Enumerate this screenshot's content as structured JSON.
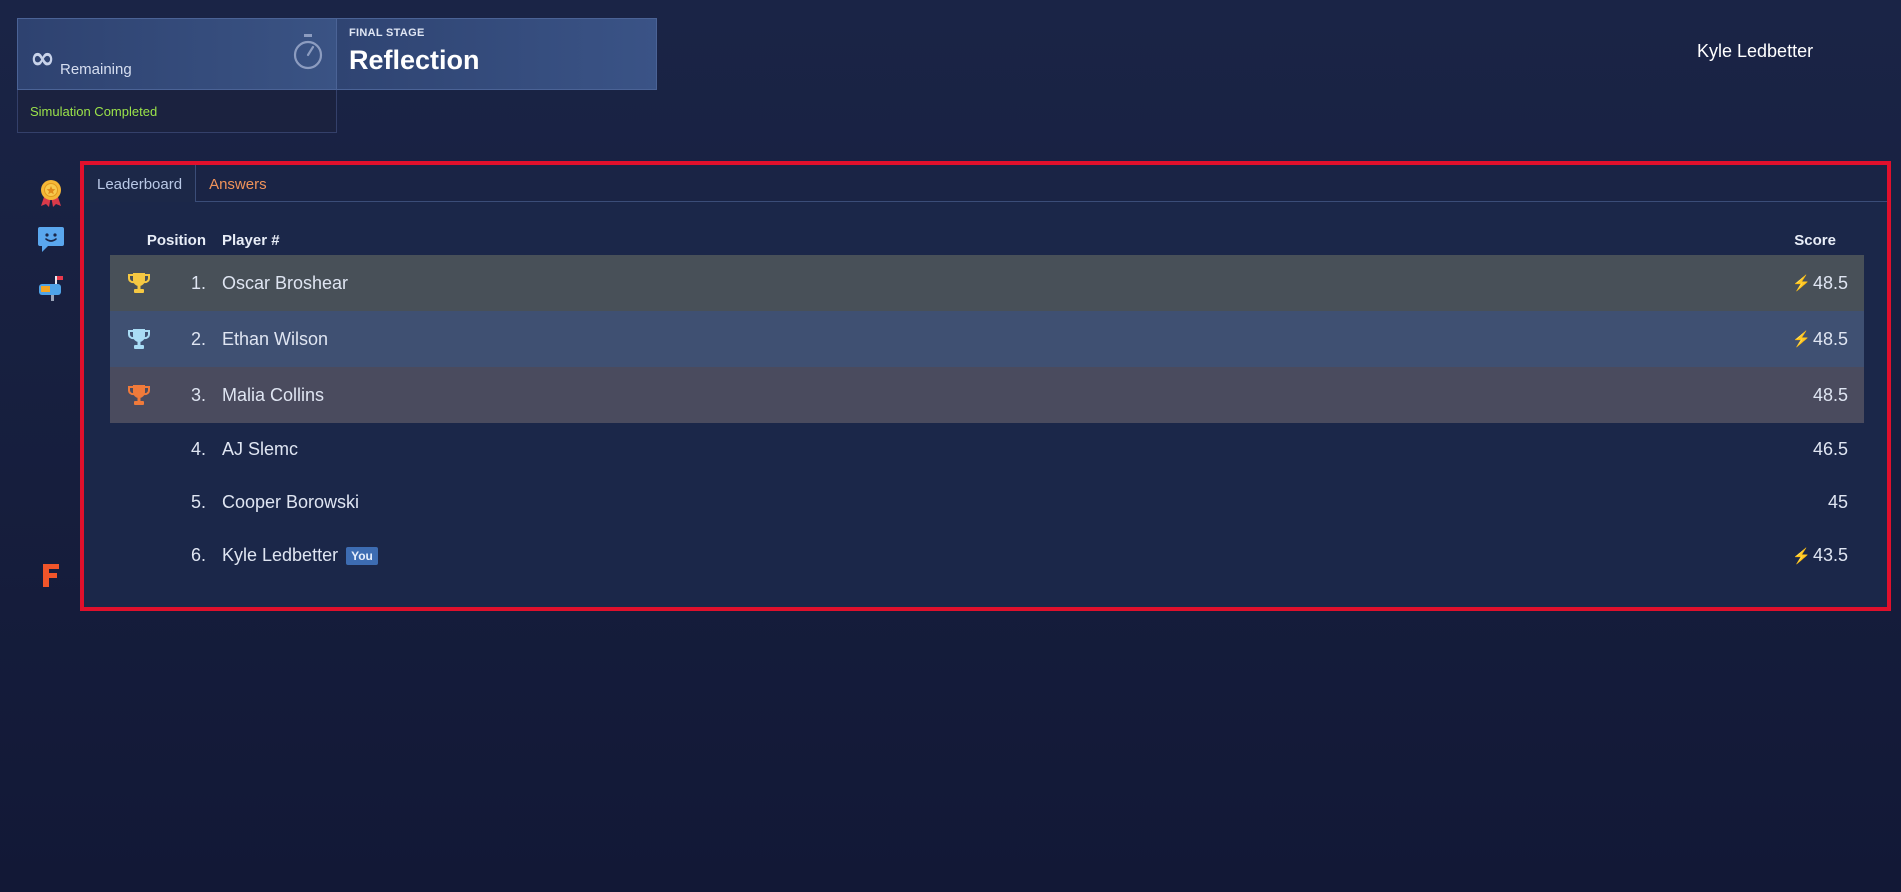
{
  "timer": {
    "remaining_symbol": "∞",
    "remaining_label": "Remaining"
  },
  "stage": {
    "label": "FINAL STAGE",
    "title": "Reflection"
  },
  "status": {
    "text": "Simulation Completed"
  },
  "user": {
    "name": "Kyle Ledbetter"
  },
  "tabs": [
    {
      "label": "Leaderboard",
      "active": true
    },
    {
      "label": "Answers",
      "active": false
    }
  ],
  "table": {
    "headers": {
      "position": "Position",
      "player": "Player #",
      "score": "Score"
    },
    "rows": [
      {
        "position": "1.",
        "name": "Oscar Broshear",
        "score": "48.5",
        "bolt": true,
        "trophy": "gold"
      },
      {
        "position": "2.",
        "name": "Ethan Wilson",
        "score": "48.5",
        "bolt": true,
        "trophy": "silver"
      },
      {
        "position": "3.",
        "name": "Malia Collins",
        "score": "48.5",
        "bolt": false,
        "trophy": "bronze"
      },
      {
        "position": "4.",
        "name": "AJ Slemc",
        "score": "46.5",
        "bolt": false
      },
      {
        "position": "5.",
        "name": "Cooper Borowski",
        "score": "45",
        "bolt": false
      },
      {
        "position": "6.",
        "name": "Kyle Ledbetter",
        "score": "43.5",
        "bolt": true,
        "badge": "You"
      }
    ]
  },
  "icons": {
    "sidebar": [
      "award-ribbon-icon",
      "chat-bubble-icon",
      "mailbox-icon",
      "brand-f-logo-icon"
    ],
    "trophy_colors": {
      "gold": "#f5c842",
      "silver": "#a9dcf5",
      "bronze": "#f07a3a"
    },
    "bolt": "⚡"
  },
  "colors": {
    "highlight_border": "#e0102c",
    "status_green": "#9be34a",
    "tab_inactive": "#f0935a"
  }
}
